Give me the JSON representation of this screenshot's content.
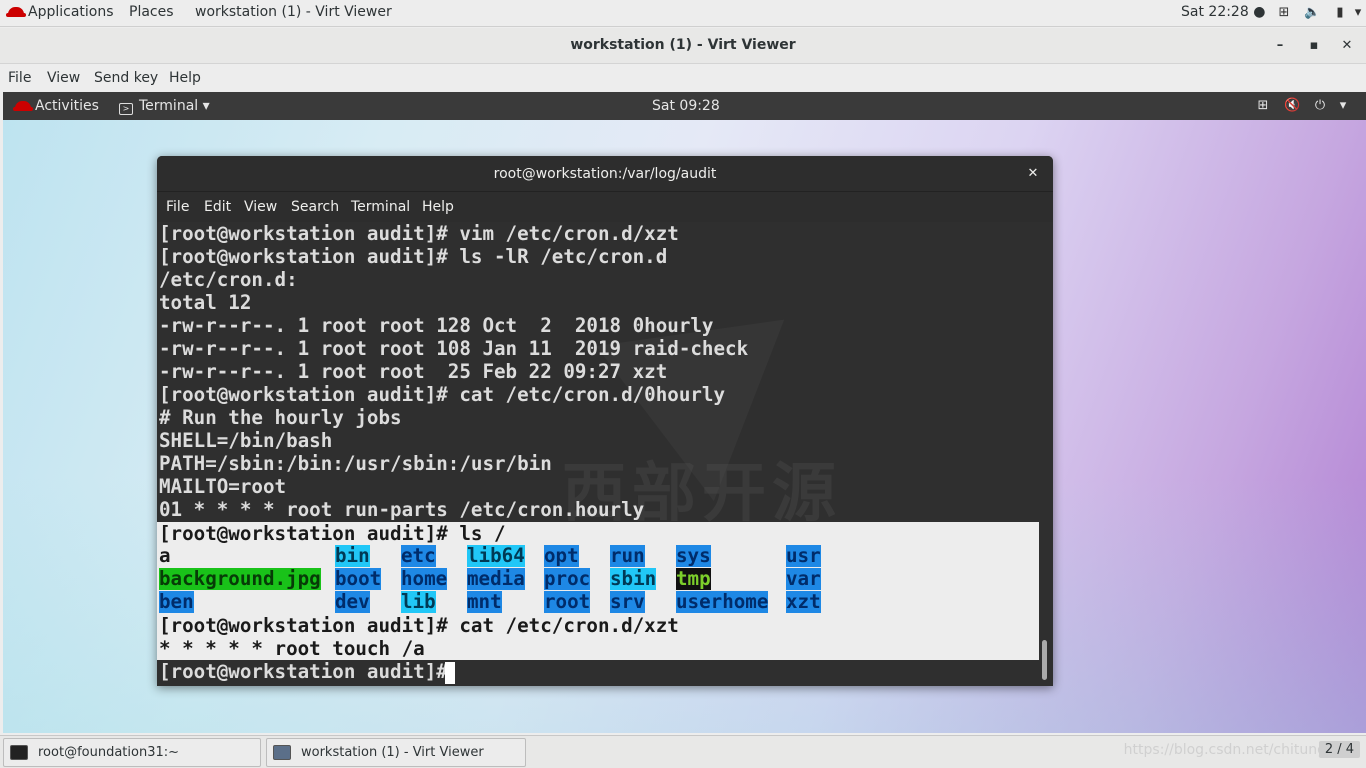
{
  "host_topbar": {
    "applications": "Applications",
    "places": "Places",
    "window": "workstation (1) - Virt Viewer",
    "clock": "Sat 22:28 ●"
  },
  "viewer": {
    "title": "workstation (1) - Virt Viewer",
    "menu": [
      "File",
      "View",
      "Send key",
      "Help"
    ]
  },
  "guest_topbar": {
    "activities": "Activities",
    "terminal": "Terminal ▾",
    "clock": "Sat 09:28"
  },
  "terminal": {
    "title": "root@workstation:/var/log/audit",
    "menu": [
      "File",
      "Edit",
      "View",
      "Search",
      "Terminal",
      "Help"
    ],
    "lines": [
      "[root@workstation audit]# vim /etc/cron.d/xzt",
      "[root@workstation audit]# ls -lR /etc/cron.d",
      "/etc/cron.d:",
      "total 12",
      "-rw-r--r--. 1 root root 128 Oct  2  2018 0hourly",
      "-rw-r--r--. 1 root root 108 Jan 11  2019 raid-check",
      "-rw-r--r--. 1 root root  25 Feb 22 09:27 xzt",
      "[root@workstation audit]# cat /etc/cron.d/0hourly",
      "# Run the hourly jobs",
      "SHELL=/bin/bash",
      "PATH=/sbin:/bin:/usr/sbin:/usr/bin",
      "MAILTO=root",
      "01 * * * * root run-parts /etc/cron.hourly"
    ],
    "ls_prompt": "[root@workstation audit]# ls /",
    "ls_entries": [
      "a",
      "bin",
      "etc",
      "lib64",
      "opt",
      "run",
      "sys",
      "usr",
      "background.jpg",
      "boot",
      "home",
      "media",
      "proc",
      "sbin",
      "tmp",
      "var",
      "ben",
      "dev",
      "lib",
      "mnt",
      "root",
      "srv",
      "userhome",
      "xzt"
    ],
    "after_lines": [
      "[root@workstation audit]# cat /etc/cron.d/xzt",
      "* * * * * root touch /a"
    ],
    "final_prompt": "[root@workstation audit]# ",
    "watermark": "西部开源"
  },
  "taskbar": {
    "task1": "root@foundation31:~",
    "task2": "workstation (1) - Virt Viewer",
    "watermark_url": "https://blog.csdn.net/chitung",
    "pager": "2 / 4"
  },
  "colors": {
    "dir": "#1e88e5",
    "dir_cyan": "#21c7f7",
    "image_file": "#19c219",
    "tmp_bg": "#111111"
  }
}
